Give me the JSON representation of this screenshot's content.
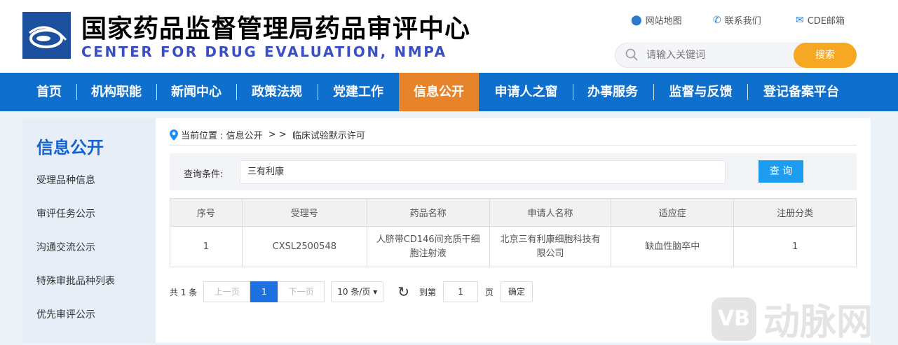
{
  "header": {
    "title_cn": "国家药品监督管理局药品审评中心",
    "title_en": "CENTER FOR DRUG EVALUATION, NMPA",
    "links": [
      {
        "icon": "location-pin-icon",
        "label": "网站地图"
      },
      {
        "icon": "phone-icon",
        "label": "联系我们"
      },
      {
        "icon": "mail-icon",
        "label": "CDE邮箱"
      }
    ],
    "search": {
      "placeholder": "请输入关键词",
      "button": "搜索"
    }
  },
  "nav": {
    "items": [
      "首页",
      "机构职能",
      "新闻中心",
      "政策法规",
      "党建工作",
      "信息公开",
      "申请人之窗",
      "办事服务",
      "监督与反馈",
      "登记备案平台"
    ],
    "active": "信息公开",
    "colors": {
      "bar": "#0f6fcd",
      "active": "#e6832b"
    }
  },
  "sidebar": {
    "title": "信息公开",
    "items": [
      "受理品种信息",
      "审评任务公示",
      "沟通交流公示",
      "特殊审批品种列表",
      "优先审评公示"
    ]
  },
  "breadcrumb": {
    "prefix": "当前位置 : 信息公开",
    "sep": " > > ",
    "current": "临床试验默示许可"
  },
  "query": {
    "label": "查询条件:",
    "value": "三有利康",
    "button": "查 询"
  },
  "table": {
    "headers": [
      "序号",
      "受理号",
      "药品名称",
      "申请人名称",
      "适应症",
      "注册分类"
    ],
    "rows": [
      [
        "1",
        "CXSL2500548",
        "人脐带CD146间充质干细胞注射液",
        "北京三有利康细胞科技有限公司",
        "缺血性脑卒中",
        "1"
      ]
    ]
  },
  "pager": {
    "total": "共 1 条",
    "prev": "上一页",
    "current": "1",
    "next": "下一页",
    "size": "10 条/页",
    "goto": "到第",
    "page_value": "1",
    "page_unit": "页",
    "confirm": "确定"
  },
  "watermark": {
    "text": "动脉网"
  }
}
